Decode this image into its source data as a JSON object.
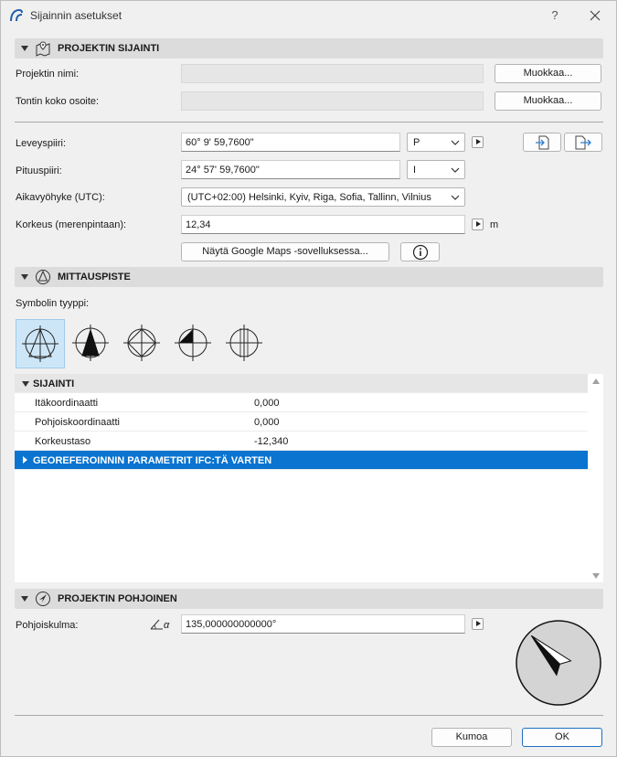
{
  "window": {
    "title": "Sijainnin asetukset",
    "help": "?"
  },
  "project_location": {
    "title": "PROJEKTIN SIJAINTI",
    "project_name_label": "Projektin nimi:",
    "project_name_value": "",
    "site_address_label": "Tontin koko osoite:",
    "site_address_value": "",
    "edit_label": "Muokkaa...",
    "latitude_label": "Leveyspiiri:",
    "latitude_value": "60° 9' 59,7600\"",
    "latitude_dir": "P",
    "longitude_label": "Pituuspiiri:",
    "longitude_value": "24° 57' 59,7600\"",
    "longitude_dir": "I",
    "timezone_label": "Aikavyöhyke (UTC):",
    "timezone_value": "(UTC+02:00) Helsinki, Kyiv, Riga, Sofia, Tallinn, Vilnius",
    "altitude_label": "Korkeus (merenpintaan):",
    "altitude_value": "12,34",
    "altitude_unit": "m",
    "maps_button": "Näytä Google Maps -sovelluksessa..."
  },
  "survey_point": {
    "title": "MITTAUSPISTE",
    "symbol_type_label": "Symbolin tyyppi:",
    "symbols": [
      "survey-symbol-1",
      "survey-symbol-2",
      "survey-symbol-3",
      "survey-symbol-4",
      "survey-symbol-5"
    ],
    "selected_symbol": 0
  },
  "tree": {
    "group_location": "SIJAINTI",
    "rows": [
      {
        "key": "Itäkoordinaatti",
        "value": "0,000"
      },
      {
        "key": "Pohjoiskoordinaatti",
        "value": "0,000"
      },
      {
        "key": "Korkeustaso",
        "value": "-12,340"
      }
    ],
    "group_ifc": "GEOREFEROINNIN PARAMETRIT IFC:TÄ VARTEN"
  },
  "project_north": {
    "title": "PROJEKTIN POHJOINEN",
    "angle_label": "Pohjoiskulma:",
    "angle_symbol": "α",
    "angle_value": "135,000000000000°",
    "angle_degrees": 135
  },
  "footer": {
    "cancel": "Kumoa",
    "ok": "OK"
  },
  "colors": {
    "selection": "#0a74d0",
    "header_bg": "#dcdcdc",
    "window_bg": "#f0f0f0"
  }
}
